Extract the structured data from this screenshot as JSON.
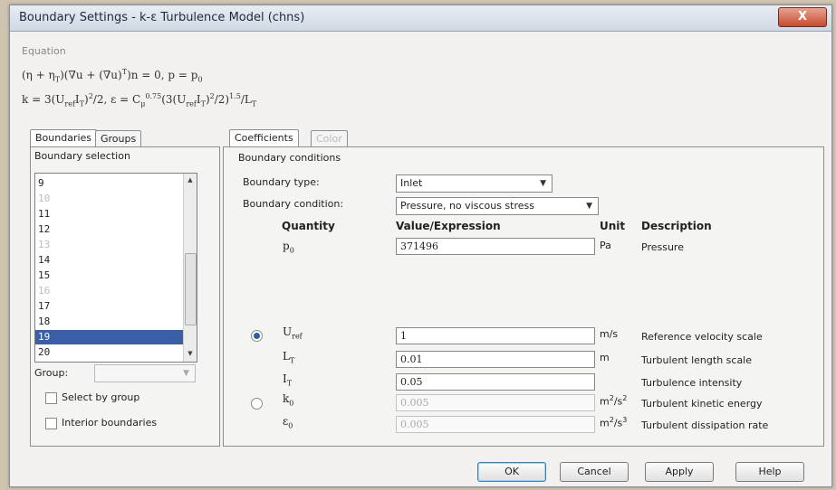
{
  "window": {
    "title": "Boundary Settings - k-ε Turbulence Model (chns)",
    "close": "X"
  },
  "equation": {
    "label": "Equation",
    "line1": "(η + ηT)(∇u + (∇u)T)n = 0, p = p0",
    "line2": "k = 3(UrefIT)²/2, ε = Cμ0.75(3(UrefIT)²/2)1.5/LT"
  },
  "left_tabs": [
    "Boundaries",
    "Groups"
  ],
  "boundary_selection": {
    "label": "Boundary selection",
    "items": [
      {
        "label": "9",
        "state": "normal"
      },
      {
        "label": "10",
        "state": "dim"
      },
      {
        "label": "11",
        "state": "normal"
      },
      {
        "label": "12",
        "state": "normal"
      },
      {
        "label": "13",
        "state": "dim"
      },
      {
        "label": "14",
        "state": "normal"
      },
      {
        "label": "15",
        "state": "normal"
      },
      {
        "label": "16",
        "state": "dim"
      },
      {
        "label": "17",
        "state": "normal"
      },
      {
        "label": "18",
        "state": "normal"
      },
      {
        "label": "19",
        "state": "selected"
      },
      {
        "label": "20",
        "state": "normal"
      }
    ],
    "group_label": "Group:",
    "select_by_group": "Select by group",
    "interior_boundaries": "Interior boundaries"
  },
  "right_tabs": {
    "coefficients": "Coefficients",
    "color": "Color"
  },
  "boundary_conditions": {
    "label": "Boundary conditions",
    "type_label": "Boundary type:",
    "type_value": "Inlet",
    "condition_label": "Boundary condition:",
    "condition_value": "Pressure, no viscous stress"
  },
  "table": {
    "headers": {
      "quantity": "Quantity",
      "value": "Value/Expression",
      "unit": "Unit",
      "description": "Description"
    },
    "p0": {
      "value": "371496",
      "unit": "Pa",
      "description": "Pressure"
    },
    "uref": {
      "value": "1",
      "unit": "m/s",
      "description": "Reference velocity scale"
    },
    "lt": {
      "value": "0.01",
      "unit": "m",
      "description": "Turbulent length scale"
    },
    "it": {
      "value": "0.05",
      "unit": "",
      "description": "Turbulence intensity"
    },
    "k0": {
      "value": "0.005",
      "description": "Turbulent kinetic energy"
    },
    "e0": {
      "value": "0.005",
      "description": "Turbulent dissipation rate"
    }
  },
  "buttons": {
    "ok": "OK",
    "cancel": "Cancel",
    "apply": "Apply",
    "help": "Help"
  },
  "colors": {
    "selection": "#3b5fa6",
    "close_button": "#c64a2e"
  }
}
